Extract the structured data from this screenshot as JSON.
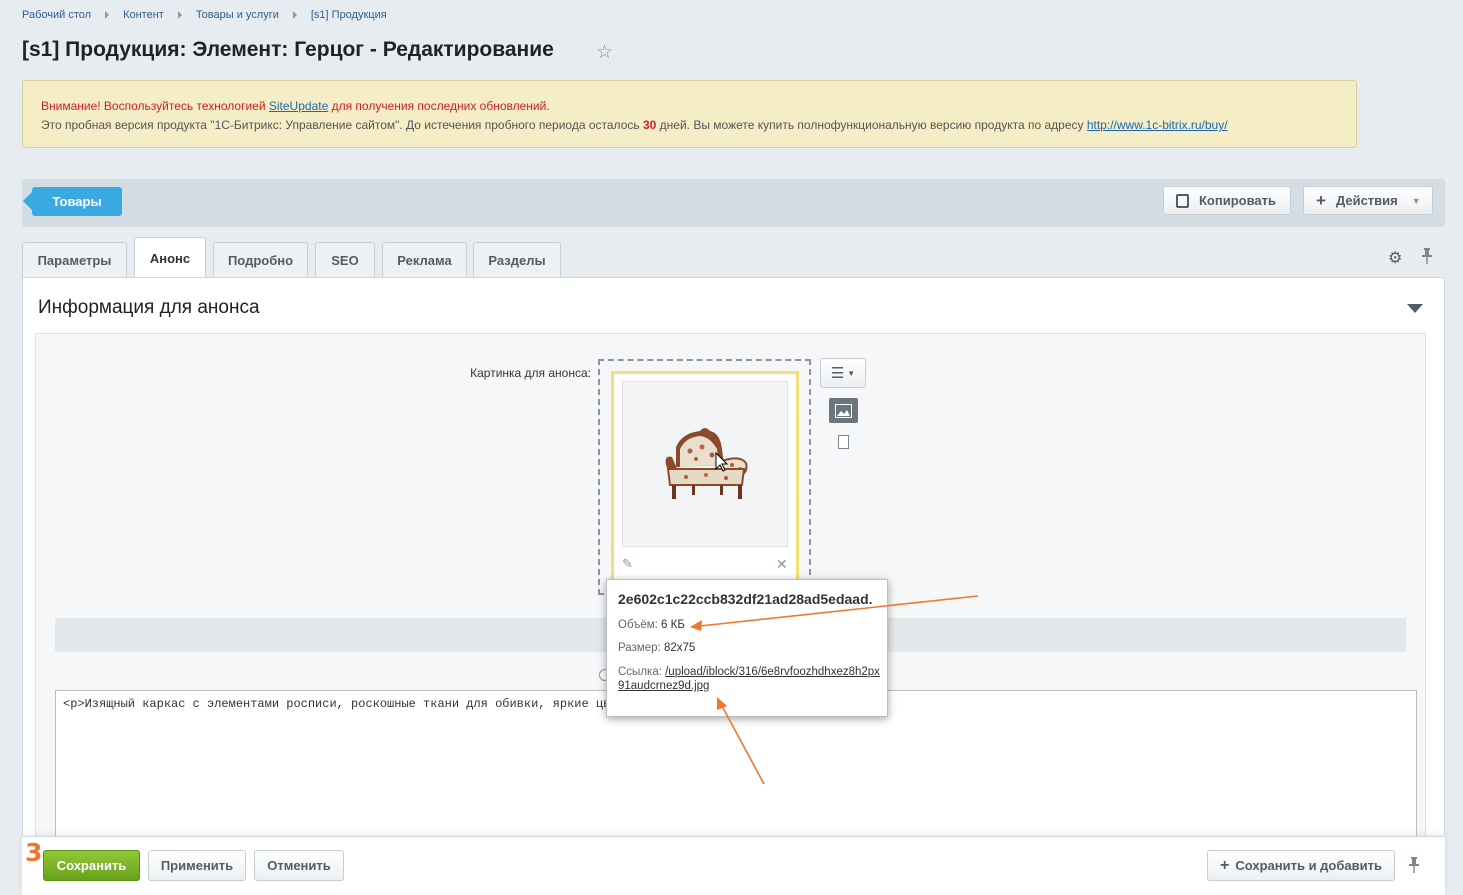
{
  "breadcrumb": [
    "Рабочий стол",
    "Контент",
    "Товары и услуги",
    "[s1] Продукция"
  ],
  "page_title": "[s1] Продукция: Элемент: Герцог - Редактирование",
  "warning": {
    "line1_prefix": "Внимание! Воспользуйтесь технологией ",
    "line1_link": "SiteUpdate",
    "line1_suffix": " для получения последних обновлений.",
    "line2_prefix": "Это пробная версия продукта \"1С-Битрикс: Управление сайтом\". До истечения пробного периода осталось ",
    "line2_days": "30",
    "line2_suffix": " дней. Вы можете купить полнофункциональную версию продукта по адресу ",
    "line2_link": "http://www.1c-bitrix.ru/buy/"
  },
  "toolbar": {
    "goods_label": "Товары",
    "copy_label": "Копировать",
    "actions_label": "Действия"
  },
  "tabs": [
    "Параметры",
    "Анонс",
    "Подробно",
    "SEO",
    "Реклама",
    "Разделы"
  ],
  "section": {
    "title": "Информация для анонса",
    "image_label": "Картинка для анонса:",
    "text_value": "<p>Изящный каркас с элементами росписи, роскошные ткани для обивки, яркие цвета и б"
  },
  "tooltip": {
    "name": "2e602c1c22ccb832df21ad28ad5edaad.",
    "size_key": "Объём:",
    "size_value": "6 КБ",
    "dim_key": "Размер:",
    "dim_value": "82x75",
    "link_key": "Ссылка:",
    "link_value": "/upload/iblock/316/6e8rvfoozhdhxez8h2px91audcrnez9d.jpg"
  },
  "footer": {
    "step_number": "3",
    "save_label": "Сохранить",
    "apply_label": "Применить",
    "cancel_label": "Отменить",
    "save_add_label": "Сохранить и добавить"
  },
  "colors": {
    "accent": "#3ba9e2",
    "save": "#7bb52a",
    "annotation": "#f0762e"
  }
}
